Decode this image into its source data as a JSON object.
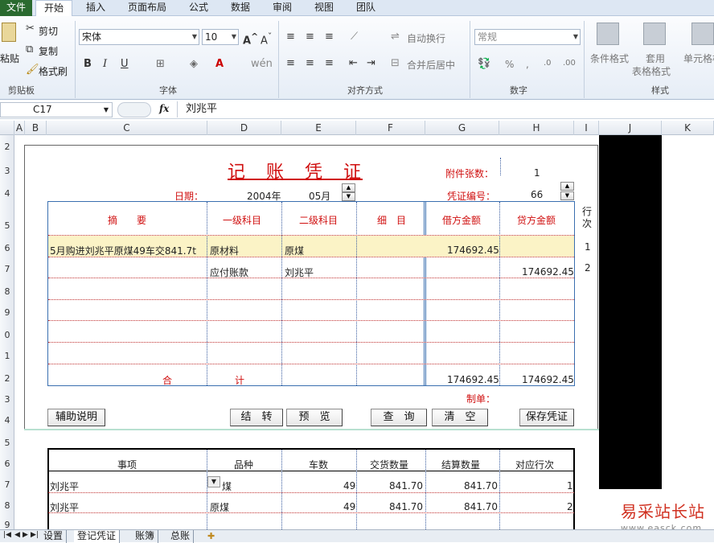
{
  "ribbon_tabs": [
    "文件",
    "开始",
    "插入",
    "页面布局",
    "公式",
    "数据",
    "审阅",
    "视图",
    "团队"
  ],
  "clipboard": {
    "paste": "粘贴",
    "cut": "剪切",
    "copy": "复制",
    "format_painter": "格式刷",
    "label": "剪贴板"
  },
  "font": {
    "name": "宋体",
    "size": "10",
    "label": "字体"
  },
  "alignment": {
    "wrap": "自动换行",
    "merge": "合并后居中",
    "label": "对齐方式"
  },
  "number": {
    "format": "常规",
    "percent": "%",
    "comma": ",",
    "label": "数字"
  },
  "styles": {
    "cond_format": "条件格式",
    "table_format_1": "套用",
    "table_format_2": "表格格式",
    "cell_styles": "单元格样",
    "label": "样式"
  },
  "formula_bar": {
    "name_box": "C17",
    "fx": "fx",
    "value": "刘兆平"
  },
  "columns": [
    "A",
    "B",
    "C",
    "D",
    "E",
    "F",
    "G",
    "H",
    "I",
    "J",
    "K"
  ],
  "rows": [
    "2",
    "3",
    "4",
    "5",
    "6",
    "7",
    "8",
    "9",
    "0",
    "1",
    "2",
    "3",
    "4",
    "5",
    "6",
    "7",
    "8",
    "9"
  ],
  "voucher": {
    "title": "记　账　凭　证",
    "attachments_label": "附件张数：",
    "attachments_value": "1",
    "date_label": "日期：",
    "year": "2004年",
    "month": "05月",
    "number_label": "凭证编号：",
    "number_value": "66",
    "headers": [
      "摘　　要",
      "一级科目",
      "二级科目",
      "细　目",
      "借方金额",
      "贷方金额"
    ],
    "row_label": "行次",
    "rows": [
      {
        "summary": "5月购进刘兆平原煤49车交841.7t",
        "account1": "原材料",
        "account2": "原煤",
        "debit": "174692.45",
        "credit": "",
        "line": "1"
      },
      {
        "summary": "",
        "account1": "应付账款",
        "account2": "刘兆平",
        "debit": "",
        "credit": "174692.45",
        "line": "2"
      }
    ],
    "total_label_1": "合",
    "total_label_2": "计",
    "total_debit": "174692.45",
    "total_credit": "174692.45",
    "maker_label": "制单："
  },
  "buttons": {
    "help": "辅助说明",
    "carry": "结　转",
    "preview": "预　览",
    "query": "查　询",
    "clear": "清　空",
    "save": "保存凭证"
  },
  "detail": {
    "headers": [
      "事项",
      "品种",
      "车数",
      "交货数量",
      "结算数量",
      "对应行次"
    ],
    "rows": [
      {
        "item": "刘兆平",
        "kind": "煤",
        "cars": "49",
        "delivered": "841.70",
        "settled": "841.70",
        "line": "1"
      },
      {
        "item": "刘兆平",
        "kind": "原煤",
        "cars": "49",
        "delivered": "841.70",
        "settled": "841.70",
        "line": "2"
      }
    ]
  },
  "sheet_tabs": [
    "设置",
    "登记凭证",
    "账簿",
    "总账"
  ],
  "watermark": {
    "text": "易采站长站",
    "url": "www.easck.com"
  }
}
